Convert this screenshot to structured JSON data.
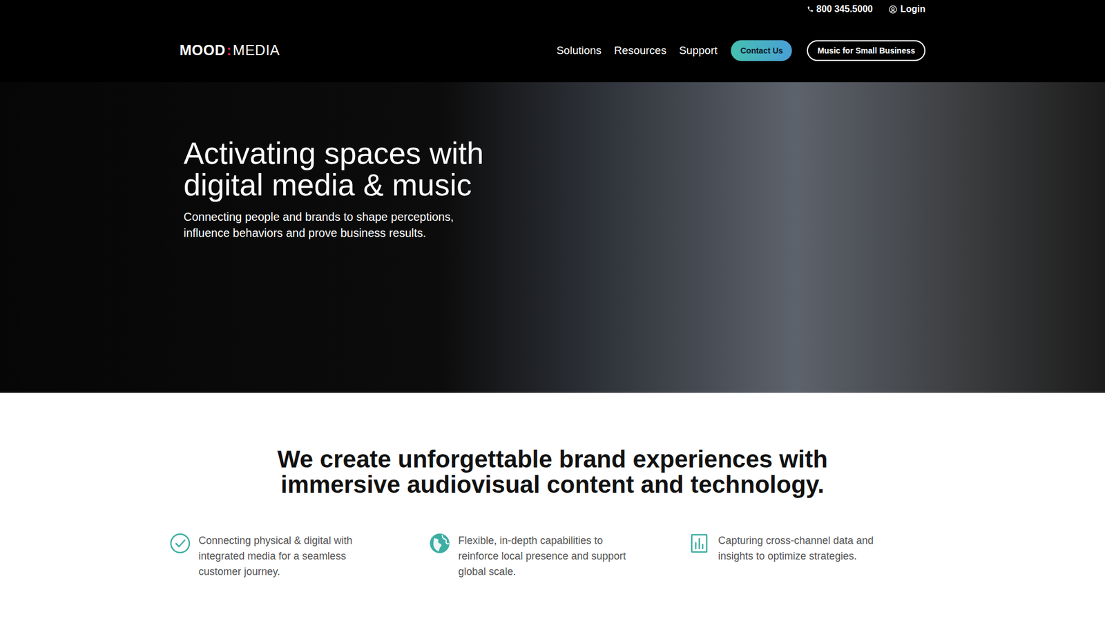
{
  "utility_bar": {
    "phone": "800 345.5000",
    "login": "Login"
  },
  "logo": {
    "left": "MOOD",
    "separator": ":",
    "right": "MEDIA"
  },
  "nav": {
    "items": [
      "Solutions",
      "Resources",
      "Support"
    ],
    "contact_button": "Contact Us",
    "small_business_button": "Music for Small Business"
  },
  "hero": {
    "title_lines": [
      "Activating spaces with",
      "digital media & music"
    ],
    "subtitle_lines": [
      "Connecting people and brands to shape perceptions,",
      "influence behaviors and prove business results."
    ]
  },
  "intro": {
    "heading_lines": [
      "We create unforgettable brand experiences with",
      "immersive audiovisual content and technology."
    ],
    "features": [
      {
        "text": "Connecting physical & digital with integrated media for a seamless customer journey.",
        "kind": "check"
      },
      {
        "text": "Flexible, in-depth capabilities to reinforce local presence and support global scale.",
        "kind": "globe"
      },
      {
        "text": "Capturing cross-channel data and insights to optimize strategies.",
        "kind": "chart"
      }
    ]
  }
}
